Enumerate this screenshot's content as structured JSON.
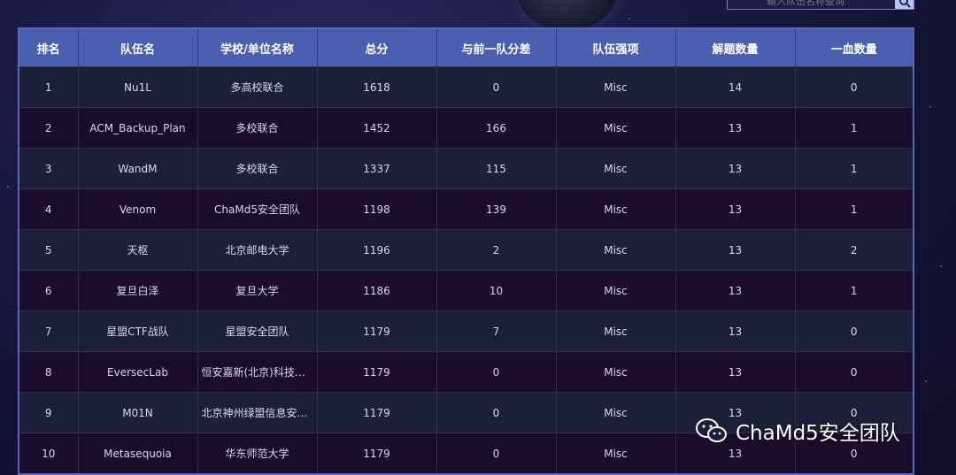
{
  "search": {
    "placeholder": "输入队伍名称查询"
  },
  "table": {
    "headers": [
      "排名",
      "队伍名",
      "学校/单位名称",
      "总分",
      "与前一队分差",
      "队伍强项",
      "解题数量",
      "一血数量"
    ],
    "rows": [
      [
        "1",
        "Nu1L",
        "多高校联合",
        "1618",
        "0",
        "Misc",
        "14",
        "0"
      ],
      [
        "2",
        "ACM_Backup_Plan",
        "多校联合",
        "1452",
        "166",
        "Misc",
        "13",
        "1"
      ],
      [
        "3",
        "WandM",
        "多校联合",
        "1337",
        "115",
        "Misc",
        "13",
        "1"
      ],
      [
        "4",
        "Venom",
        "ChaMd5安全团队",
        "1198",
        "139",
        "Misc",
        "13",
        "1"
      ],
      [
        "5",
        "天枢",
        "北京邮电大学",
        "1196",
        "2",
        "Misc",
        "13",
        "2"
      ],
      [
        "6",
        "复旦白泽",
        "复旦大学",
        "1186",
        "10",
        "Misc",
        "13",
        "1"
      ],
      [
        "7",
        "星盟CTF战队",
        "星盟安全团队",
        "1179",
        "7",
        "Misc",
        "13",
        "0"
      ],
      [
        "8",
        "EversecLab",
        "恒安嘉新(北京)科技股...",
        "1179",
        "0",
        "Misc",
        "13",
        "0"
      ],
      [
        "9",
        "M01N",
        "北京神州绿盟信息安全...",
        "1179",
        "0",
        "Misc",
        "13",
        "0"
      ],
      [
        "10",
        "Metasequoia",
        "华东师范大学",
        "1179",
        "0",
        "Misc",
        "13",
        "0"
      ]
    ]
  },
  "watermark": {
    "text": "ChaMd5安全团队"
  },
  "colors": {
    "header_bg": "#4a5fb0",
    "row_odd": "#1c1f38",
    "row_even": "#1a0c2a"
  }
}
